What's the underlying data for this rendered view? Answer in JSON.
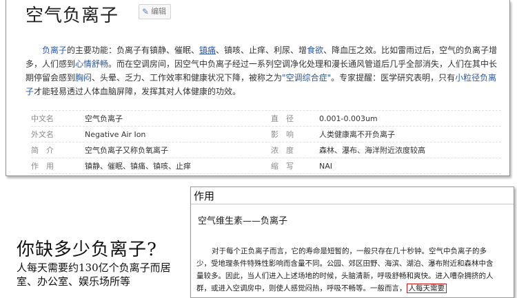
{
  "article": {
    "title": "空气负离子",
    "edit_label": "编辑",
    "intro": {
      "t1": "负离子",
      "t2": "的主要功能：负离子有镇静、催眠、",
      "t3": "镇痛",
      "t4": "、镇咳、止痒、利尿、增",
      "t5": "食欲",
      "t6": "、降血压之效。比如雷雨过后，空气的负离子增多，人们感到",
      "t7": "心情舒畅",
      "t8": "。而在空调房间，因空气中负离子经过一系列空调净化处理和漫长通风管道后几乎全部消失，人们在其中长期停留会感到",
      "t9": "胸闷",
      "t10": "、头晕、乏力、工作效率和健康状况下降，被称之为",
      "t11": "\"空调综合症\"",
      "t12": "。专家提醒：医学研究表明，只有",
      "t13": "小粒径负离子",
      "t14": "才能轻易透过人体血脑屏障，发挥其对人体健康的功效。"
    },
    "info": [
      {
        "label": "中文名",
        "value": "空气负离子",
        "label2": "直　径",
        "value2": "0.001-0.003um"
      },
      {
        "label": "外文名",
        "value": "Negative Air Ion",
        "label2": "影　响",
        "value2": "人类健康离不开负离子"
      },
      {
        "label": "简　介",
        "value": "空气负离子又称负氧离子",
        "label2": "浓　度",
        "value2": "森林、瀑布、海洋附近浓度较高"
      },
      {
        "label": "作　用",
        "value": "镇静、催眠、镇痛、镇咳、止痒",
        "label2": "缩　写",
        "value2": "NAI"
      }
    ]
  },
  "poster": {
    "headline": "你缺多少负离子?",
    "sub": "人每天需要约130亿个负离子而居室、办公室、娱乐场所等"
  },
  "panel": {
    "title": "作用",
    "subtitle": "空气维生素——负离子",
    "para": "对于每个正负离子而言，它的寿命是短暂的，一般只存在几十秒钟。空气中负离子的多少，受地理条件特殊性影响而含量不同。公园、郊区田野、海滨、湖泊、瀑布附近和森林中含量较多。因此，当人们进入上述场地的时候，头脑清新，呼吸舒畅和爽快。进入嘈杂拥挤的人群，或进入空调房中，则使人感觉闷热，呼吸不畅等。一般而言，",
    "highlight": "人每天需要"
  }
}
